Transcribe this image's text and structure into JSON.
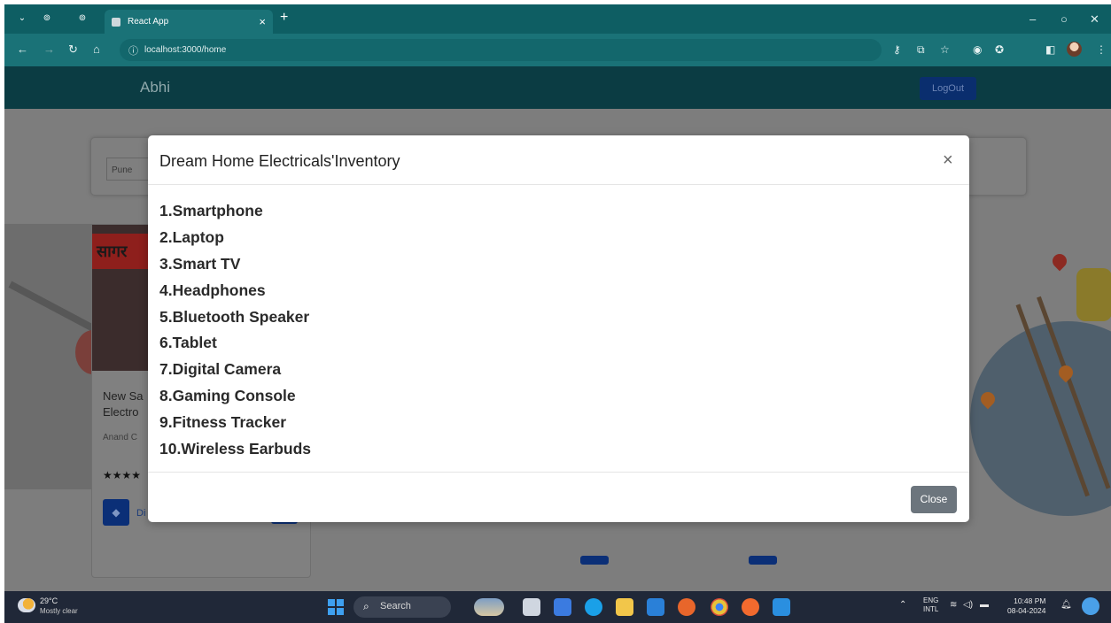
{
  "browser": {
    "tab_title": "React App",
    "url": "localhost:3000/home"
  },
  "app": {
    "brand": "Abhi",
    "logout_label": "LogOut",
    "city_value": "Pune",
    "card": {
      "title_line1": "New Sa",
      "title_line2": "Electro",
      "address": "Anand C",
      "rating_stars": "★★★★",
      "directions_label": "Di"
    },
    "signboard_text": "सागर"
  },
  "modal": {
    "title": "Dream Home Electricals'Inventory",
    "close_icon": "×",
    "items": [
      "1.Smartphone",
      "2.Laptop",
      "3.Smart TV",
      "4.Headphones",
      "5.Bluetooth Speaker",
      "6.Tablet",
      "7.Digital Camera",
      "8.Gaming Console",
      "9.Fitness Tracker",
      "10.Wireless Earbuds"
    ],
    "close_button_label": "Close"
  },
  "taskbar": {
    "temperature": "29°C",
    "weather": "Mostly clear",
    "search_label": "Search",
    "lang_line1": "ENG",
    "lang_line2": "INTL",
    "time": "10:48 PM",
    "date": "08-04-2024"
  },
  "colors": {
    "chrome": "#0e5e63",
    "modal_close_button": "#6c757d"
  }
}
